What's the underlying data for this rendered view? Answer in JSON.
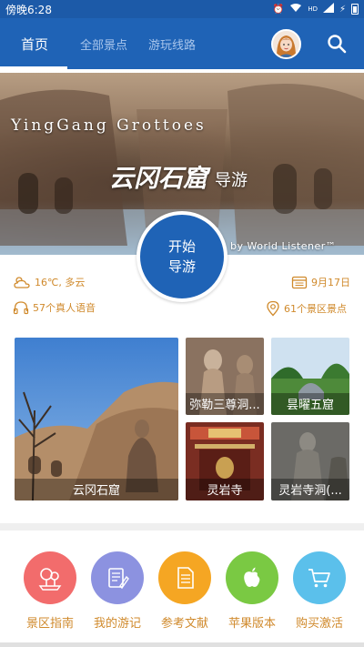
{
  "status_bar": {
    "time": "傍晚6:28",
    "hd": "HD"
  },
  "app_bar": {
    "tabs": [
      {
        "label": "首页",
        "active": true
      },
      {
        "label": "全部景点",
        "active": false
      },
      {
        "label": "游玩线路",
        "active": false
      }
    ],
    "accent_color": "#1f63b6"
  },
  "hero": {
    "title_en": "YingGang Grottoes",
    "title_cn": "云冈石窟",
    "title_suffix": "导游",
    "byline": "by World Listener™"
  },
  "start_button": {
    "line1": "开始",
    "line2": "导游"
  },
  "info": {
    "weather": "16℃, 多云",
    "date": "9月17日",
    "audio": "57个真人语音",
    "spots": "61个景区景点",
    "text_color": "#d08a2c"
  },
  "photos": [
    {
      "label": "云冈石窟"
    },
    {
      "label": "弥勒三尊洞..."
    },
    {
      "label": "昙曜五窟"
    },
    {
      "label": "灵岩寺"
    },
    {
      "label": "灵岩寺洞(..."
    }
  ],
  "shortcuts": [
    {
      "label": "景区指南",
      "icon": "tree-map-icon",
      "color": "#f26c6c"
    },
    {
      "label": "我的游记",
      "icon": "notebook-pen-icon",
      "color": "#8c92e0"
    },
    {
      "label": "参考文献",
      "icon": "document-icon",
      "color": "#f5a623"
    },
    {
      "label": "苹果版本",
      "icon": "apple-icon",
      "color": "#7ac943"
    },
    {
      "label": "购买激活",
      "icon": "cart-icon",
      "color": "#5bc0eb"
    }
  ]
}
